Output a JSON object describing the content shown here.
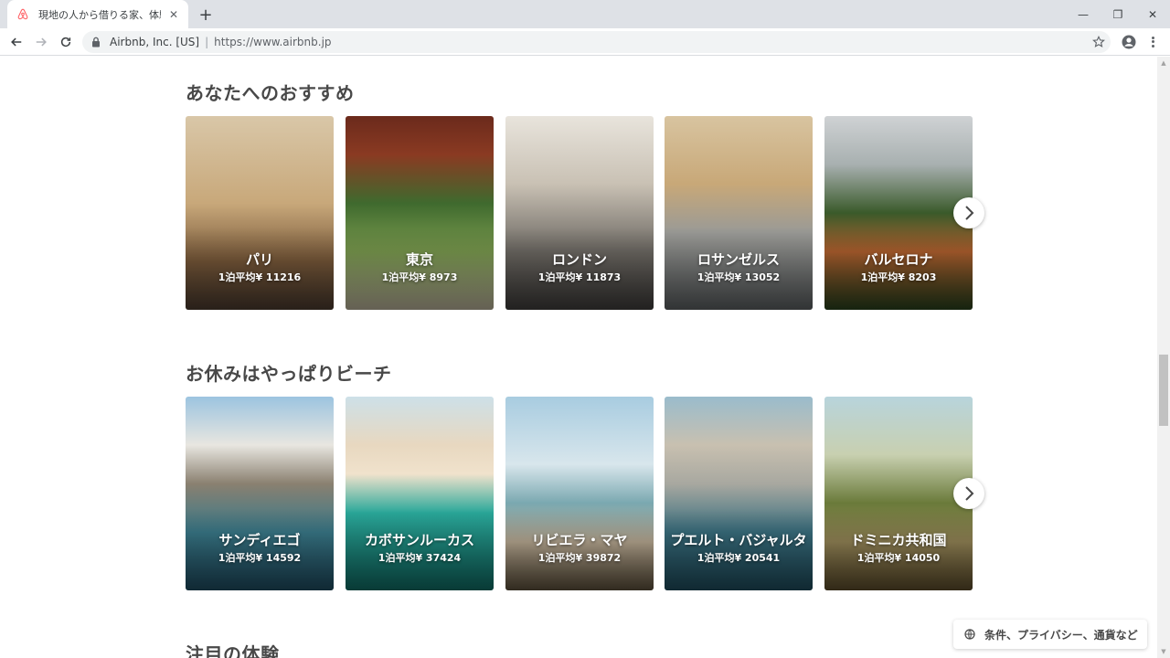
{
  "browser": {
    "tab_title": "現地の人から借りる家、体験&スポット",
    "tab_close": "✕",
    "new_tab": "+",
    "site_identity": "Airbnb, Inc. [US]",
    "separator": "|",
    "url": "https://www.airbnb.jp",
    "window_controls": {
      "minimize": "—",
      "restore": "❐",
      "close": "✕"
    }
  },
  "sections": [
    {
      "title": "あなたへのおすすめ",
      "cards": [
        {
          "city": "パリ",
          "price": "1泊平均¥ 11216"
        },
        {
          "city": "東京",
          "price": "1泊平均¥ 8973"
        },
        {
          "city": "ロンドン",
          "price": "1泊平均¥ 11873"
        },
        {
          "city": "ロサンゼルス",
          "price": "1泊平均¥ 13052"
        },
        {
          "city": "バルセロナ",
          "price": "1泊平均¥ 8203"
        }
      ]
    },
    {
      "title": "お休みはやっぱりビーチ",
      "cards": [
        {
          "city": "サンディエゴ",
          "price": "1泊平均¥ 14592"
        },
        {
          "city": "カボサンルーカス",
          "price": "1泊平均¥ 37424"
        },
        {
          "city": "リビエラ・マヤ",
          "price": "1泊平均¥ 39872"
        },
        {
          "city": "プエルト・バジャルタ",
          "price": "1泊平均¥ 20541"
        },
        {
          "city": "ドミニカ共和国",
          "price": "1泊平均¥ 14050"
        }
      ]
    },
    {
      "title": "注目の体験"
    }
  ],
  "footer": {
    "label": "条件、プライバシー、通貨など"
  },
  "colors": {
    "brand": "#FF5A5F",
    "text": "#484848"
  }
}
